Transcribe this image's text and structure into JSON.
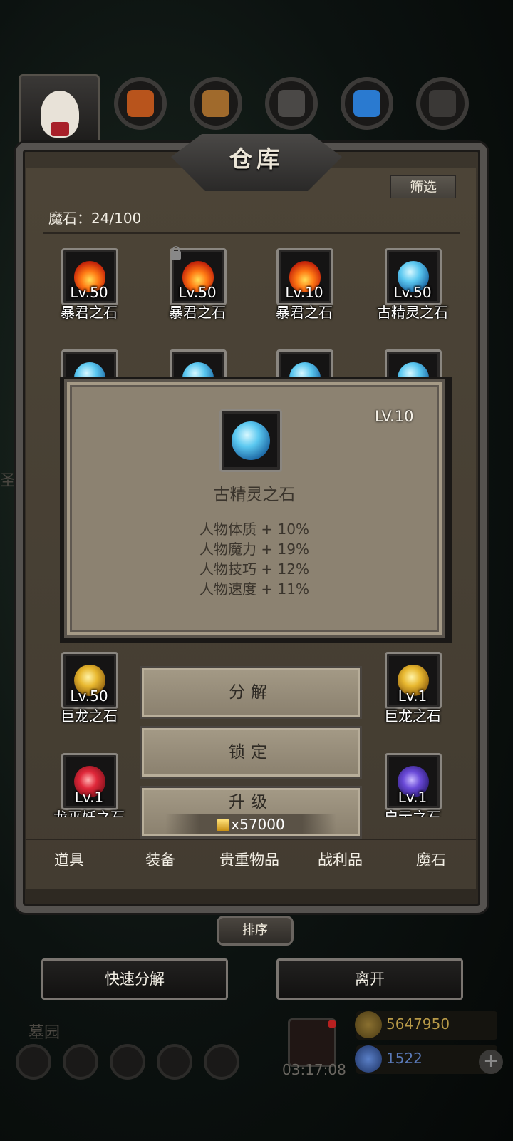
{
  "panel": {
    "title": "仓库",
    "filter_label": "筛选",
    "stone_count": "魔石：24/100"
  },
  "items": [
    {
      "lv": "Lv.50",
      "name": "暴君之石",
      "gem": "fire",
      "locked": false
    },
    {
      "lv": "Lv.50",
      "name": "暴君之石",
      "gem": "fire",
      "locked": true
    },
    {
      "lv": "Lv.10",
      "name": "暴君之石",
      "gem": "fire",
      "locked": false
    },
    {
      "lv": "Lv.50",
      "name": "古精灵之石",
      "gem": "elf",
      "locked": false
    },
    {
      "lv": "Lv.50",
      "name": "巨龙之石",
      "gem": "dragon",
      "locked": false
    },
    {
      "lv": "Lv.1",
      "name": "巨龙之石",
      "gem": "dragon",
      "locked": false
    },
    {
      "lv": "Lv.1",
      "name": "龙巫妖之石",
      "gem": "demon",
      "locked": false
    },
    {
      "lv": "Lv.1",
      "name": "启示之石",
      "gem": "oracle",
      "locked": false
    }
  ],
  "tabs": [
    "道具",
    "装备",
    "贵重物品",
    "战利品",
    "魔石"
  ],
  "sort_label": "排序",
  "bottom": {
    "quick_decompose": "快速分解",
    "leave": "离开"
  },
  "popup": {
    "level": "LV.10",
    "name": "古精灵之石",
    "stats": [
      "人物体质 + 10%",
      "人物魔力 + 19%",
      "人物技巧 + 12%",
      "人物速度 + 11%"
    ]
  },
  "actions": {
    "decompose": "分解",
    "lock": "锁定",
    "upgrade": "升级",
    "upgrade_cost": "x57000"
  },
  "hud": {
    "location": "墓园",
    "timer": "03:17:08",
    "gold": "5647950",
    "gems": "1522"
  },
  "colors": {
    "panel_bg": "#4a4235",
    "popup_bg": "#8c8271",
    "gold_text": "#b89a48",
    "gem_text": "#5a7ab8"
  }
}
